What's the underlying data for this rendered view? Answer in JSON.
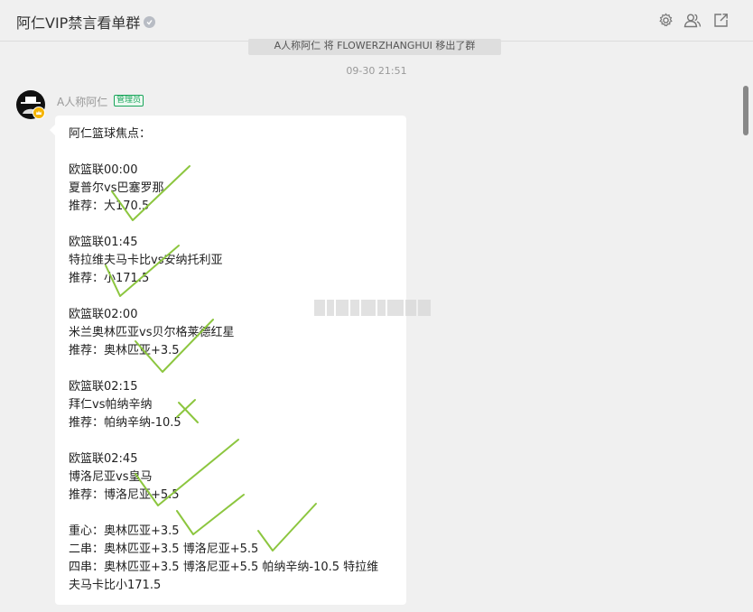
{
  "header": {
    "title": "阿仁VIP禁言看单群",
    "icons": [
      "gear-icon",
      "group-icon",
      "share-icon"
    ]
  },
  "system_note": "A人称阿仁 将 FLOWERZHANGHUI 移出了群",
  "timestamp": "09-30 21:51",
  "message": {
    "sender": "A人称阿仁",
    "badge": "管理员",
    "lines": [
      "阿仁篮球焦点：",
      "",
      "欧篮联00:00",
      "夏普尔vs巴塞罗那",
      "推荐：大170.5",
      "",
      "欧篮联01:45",
      "特拉维夫马卡比vs安纳托利亚",
      "推荐：小171.5",
      "",
      "欧篮联02:00",
      "米兰奥林匹亚vs贝尔格莱德红星",
      "推荐：奥林匹亚+3.5",
      "",
      "欧篮联02:15",
      "拜仁vs帕纳辛纳",
      "推荐：帕纳辛纳-10.5",
      "",
      "欧篮联02:45",
      "博洛尼亚vs皇马",
      "推荐：博洛尼亚+5.5",
      "",
      "重心：奥林匹亚+3.5",
      "二串：奥林匹亚+3.5 博洛尼亚+5.5",
      "四串：奥林匹亚+3.5 博洛尼亚+5.5 帕纳辛纳-10.5 特拉维",
      "夫马卡比小171.5"
    ]
  },
  "colors": {
    "background": "#f0f0f0",
    "bubble": "#ffffff",
    "admin_badge": "#19a55a",
    "handwritten_marks": "#8cc63f"
  }
}
